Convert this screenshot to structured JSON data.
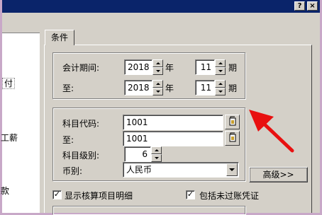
{
  "window": {
    "help_button": "?",
    "close_button": "×"
  },
  "left_list": {
    "items": [
      "付",
      "工薪",
      "款"
    ]
  },
  "tab": {
    "label": "条件"
  },
  "period": {
    "from_label": "会计期间:",
    "to_label": "至:",
    "from_year": "2018",
    "from_period": "11",
    "to_year": "2018",
    "to_period": "11",
    "year_unit": "年",
    "period_unit": "期"
  },
  "account": {
    "code_label": "科目代码:",
    "code_from": "1001",
    "to_label": "至:",
    "code_to": "1001",
    "level_label": "科目级别:",
    "level_value": "6",
    "currency_label": "币别:",
    "currency_value": "人民币"
  },
  "advanced_button": "高级>>",
  "options": {
    "show_detail_label": "显示核算项目明细",
    "show_detail_checked": true,
    "include_unposted_label": "包括未过账凭证",
    "include_unposted_checked": true
  },
  "colors": {
    "arrow": "#e81010",
    "titlebar": "#0a246a"
  },
  "icons": [
    "help-icon",
    "close-icon",
    "account-lookup-icon",
    "chevron-down-icon",
    "spin-up-icon",
    "spin-down-icon",
    "red-arrow-annotation"
  ]
}
